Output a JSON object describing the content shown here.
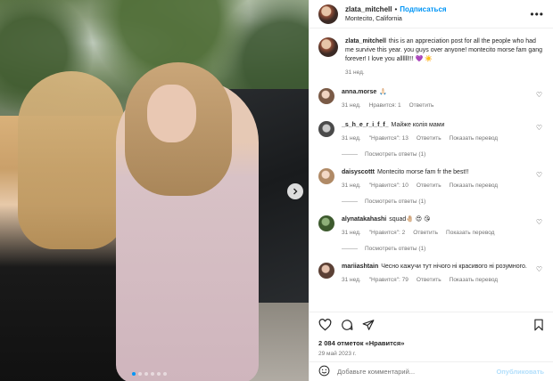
{
  "post": {
    "author": "zlata_mitchell",
    "separator": "•",
    "follow_label": "Подписаться",
    "location": "Montecito, California",
    "more_icon": "more-horizontal-icon",
    "caption": "this is an appreciation post for all the people who had me survive this year. you guys over anyone! montecito morse fam gang forever! I love you allllll!!! 💜 ☀️",
    "caption_age": "31 нед."
  },
  "carousel": {
    "dot_count": 6,
    "active_dot": 0,
    "next_icon": "chevron-right-icon"
  },
  "comments": [
    {
      "user": "anna.morse",
      "text": "🙏🏻",
      "age": "31 нед.",
      "likes": "Нравится: 1",
      "reply": "Ответить",
      "translate": "",
      "view_replies": ""
    },
    {
      "user": "_s_h_e_r_i_f_f_",
      "text": "Майже колія мами",
      "age": "31 нед.",
      "likes": "\"Нравится\": 13",
      "reply": "Ответить",
      "translate": "Показать перевод",
      "view_replies": "Посмотреть ответы (1)"
    },
    {
      "user": "daisyscottt",
      "text": "Montecito morse fam fr the best!!",
      "age": "31 нед.",
      "likes": "\"Нравится\": 10",
      "reply": "Ответить",
      "translate": "Показать перевод",
      "view_replies": "Посмотреть ответы (1)"
    },
    {
      "user": "alynatakahashi",
      "text": "squad🤚🏼 😍 😘",
      "age": "31 нед.",
      "likes": "\"Нравится\": 2",
      "reply": "Ответить",
      "translate": "Показать перевод",
      "view_replies": "Посмотреть ответы (1)"
    },
    {
      "user": "mariiashtain",
      "text": "Чесно кажучи тут нічого ні красивого ні розумного.",
      "age": "31 нед.",
      "likes": "\"Нравится\": 79",
      "reply": "Ответить",
      "translate": "Показать перевод",
      "view_replies": ""
    }
  ],
  "actions": {
    "icons": [
      "heart-icon",
      "comment-icon",
      "share-icon",
      "bookmark-icon"
    ],
    "likes_count": "2 084",
    "likes_suffix": "отметок «Нравится»",
    "date": "29 май 2023 г."
  },
  "add_comment": {
    "emoji_icon": "emoji-icon",
    "placeholder": "Добавьте комментарий...",
    "publish_label": "Опубликовать"
  },
  "colors": {
    "accent": "#0095f6",
    "muted": "#737373",
    "publish_disabled": "#b2dffc"
  }
}
